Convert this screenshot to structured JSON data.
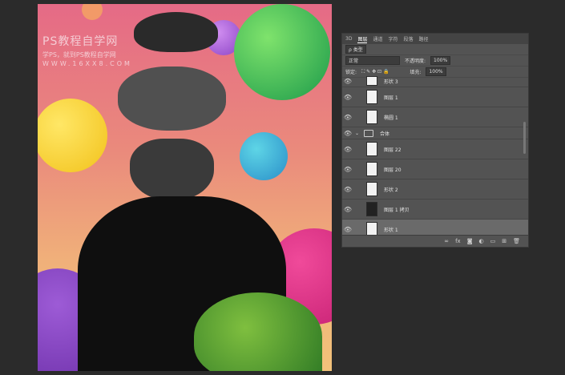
{
  "watermark": {
    "line1": "PS教程自学网",
    "line2": "学PS，就到PS教程自学网",
    "line3": "WWW.16XX8.COM"
  },
  "panel": {
    "tabs": [
      "3D",
      "图层",
      "通道",
      "字符",
      "段落",
      "路径"
    ],
    "active_tab": "图层",
    "kind_label": "ρ 类型",
    "blend_mode": "正常",
    "opacity_label": "不透明度:",
    "opacity_value": "100%",
    "lock_label": "锁定:",
    "fill_label": "填充:",
    "fill_value": "100%",
    "layers": [
      {
        "name": "形状 3"
      },
      {
        "name": "图层 1"
      },
      {
        "name": "椭圆 1"
      },
      {
        "name": "合体"
      },
      {
        "name": "图层 22"
      },
      {
        "name": "图层 20"
      },
      {
        "name": "形状 2"
      },
      {
        "name": "图层 1 拷贝"
      },
      {
        "name": "形状 1"
      }
    ]
  },
  "colors": {
    "canvas_top": "#e56a86",
    "canvas_bottom": "#f2c27a",
    "app_bg": "#2b2b2b",
    "panel_bg": "#535353"
  }
}
